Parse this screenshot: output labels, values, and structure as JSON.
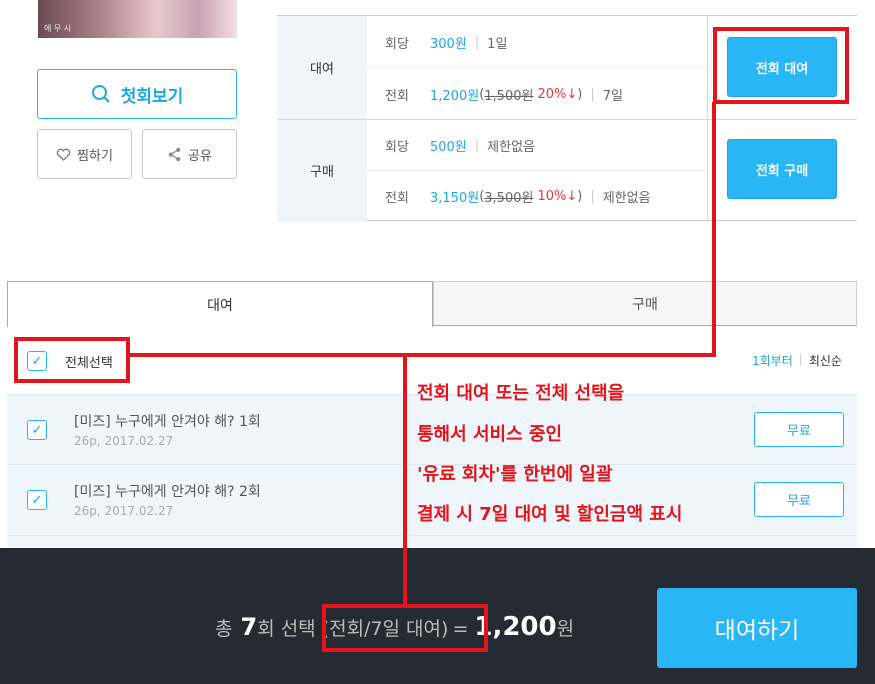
{
  "cover": {
    "text": "에 무 시"
  },
  "preview_button": "첫회보기",
  "like_button": "찜하기",
  "share_button": "공유",
  "pricing": {
    "rent": {
      "type": "대여",
      "per_episode": {
        "label": "회당",
        "price": "300원",
        "term": "1일"
      },
      "all": {
        "label": "전회",
        "price": "1,200원",
        "orig_open": "(",
        "original": "1,500원",
        "discount": "20%↓",
        "close": ")",
        "term": "7일"
      },
      "button": "전회 대여"
    },
    "buy": {
      "type": "구매",
      "per_episode": {
        "label": "회당",
        "price": "500원",
        "term": "제한없음"
      },
      "all": {
        "label": "전회",
        "price": "3,150원",
        "orig_open": "(",
        "original": "3,500원",
        "discount": "10%↓",
        "close": ")",
        "term": "제한없음"
      },
      "button": "전회 구매"
    }
  },
  "tabs": {
    "rent": "대여",
    "buy": "구매"
  },
  "select_all": {
    "label": "전체선택",
    "checked": true
  },
  "sort": {
    "first": "1회부터",
    "latest": "최신순"
  },
  "episodes": [
    {
      "title": "[미즈] 누구에게 안겨야 해? 1회",
      "meta": "26p, 2017.02.27",
      "button": "무료",
      "checked": true
    },
    {
      "title": "[미즈] 누구에게 안겨야 해? 2회",
      "meta": "26p, 2017.02.27",
      "button": "무료",
      "checked": true
    }
  ],
  "footer": {
    "prefix": "총",
    "count": "7",
    "middle": "회 선택",
    "detail": "(전회/7일 대여)",
    "equals": "=",
    "total": "1,200",
    "unit": "원",
    "rent_button": "대여하기"
  },
  "annotation": {
    "lines": [
      "전회 대여 또는 전체 선택을",
      "통해서 서비스 중인",
      "'유료 회차'를 한번에 일괄",
      "결제 시 7일 대여 및 할인금액 표시"
    ],
    "color": "#e3141b"
  },
  "colors": {
    "accent": "#29b6f6",
    "footer_bg": "#262b33",
    "discount": "#e53935"
  }
}
